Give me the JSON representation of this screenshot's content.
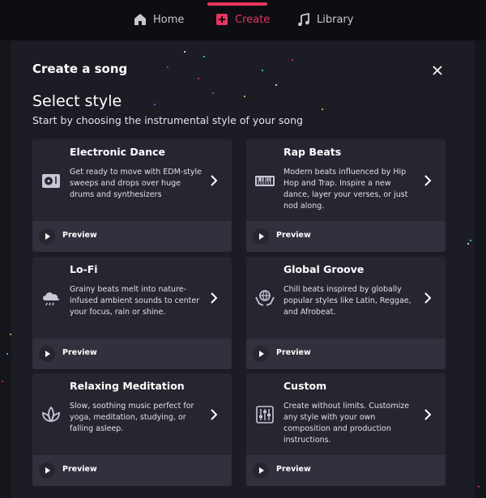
{
  "nav": {
    "items": [
      {
        "label": "Home",
        "icon": "home-icon"
      },
      {
        "label": "Create",
        "icon": "plus-square-icon",
        "active": true
      },
      {
        "label": "Library",
        "icon": "music-note-icon"
      }
    ],
    "active_color": "#e8345f"
  },
  "dialog": {
    "title": "Create a song",
    "heading": "Select style",
    "subheading": "Start by choosing the instrumental style of your song"
  },
  "cards": [
    {
      "title": "Electronic Dance",
      "description": "Get ready to move with EDM-style sweeps and drops over huge drums and synthesizers",
      "icon": "turntable-icon",
      "preview_label": "Preview"
    },
    {
      "title": "Rap Beats",
      "description": "Modern beats influenced by Hip Hop and Trap. Inspire a new dance, layer your verses, or just nod along.",
      "icon": "keyboard-icon",
      "preview_label": "Preview"
    },
    {
      "title": "Lo-Fi",
      "description": "Grainy beats melt into nature-infused ambient sounds to center your focus, rain or shine.",
      "icon": "rain-cloud-icon",
      "preview_label": "Preview"
    },
    {
      "title": "Global Groove",
      "description": "Chill beats inspired by globally popular styles like Latin, Reggae, and Afrobeat.",
      "icon": "globe-hands-icon",
      "preview_label": "Preview"
    },
    {
      "title": "Relaxing Meditation",
      "description": "Slow, soothing music perfect for yoga, meditation, studying, or falling asleep.",
      "icon": "lotus-icon",
      "preview_label": "Preview"
    },
    {
      "title": "Custom",
      "description": "Create without limits. Customize any style with your own composition and production instructions.",
      "icon": "sliders-icon",
      "preview_label": "Preview"
    }
  ],
  "colors": {
    "background": "#15151c",
    "panel": "#1c1c25",
    "card": "#262631",
    "card_footer": "#31313d",
    "accent": "#e8345f"
  }
}
